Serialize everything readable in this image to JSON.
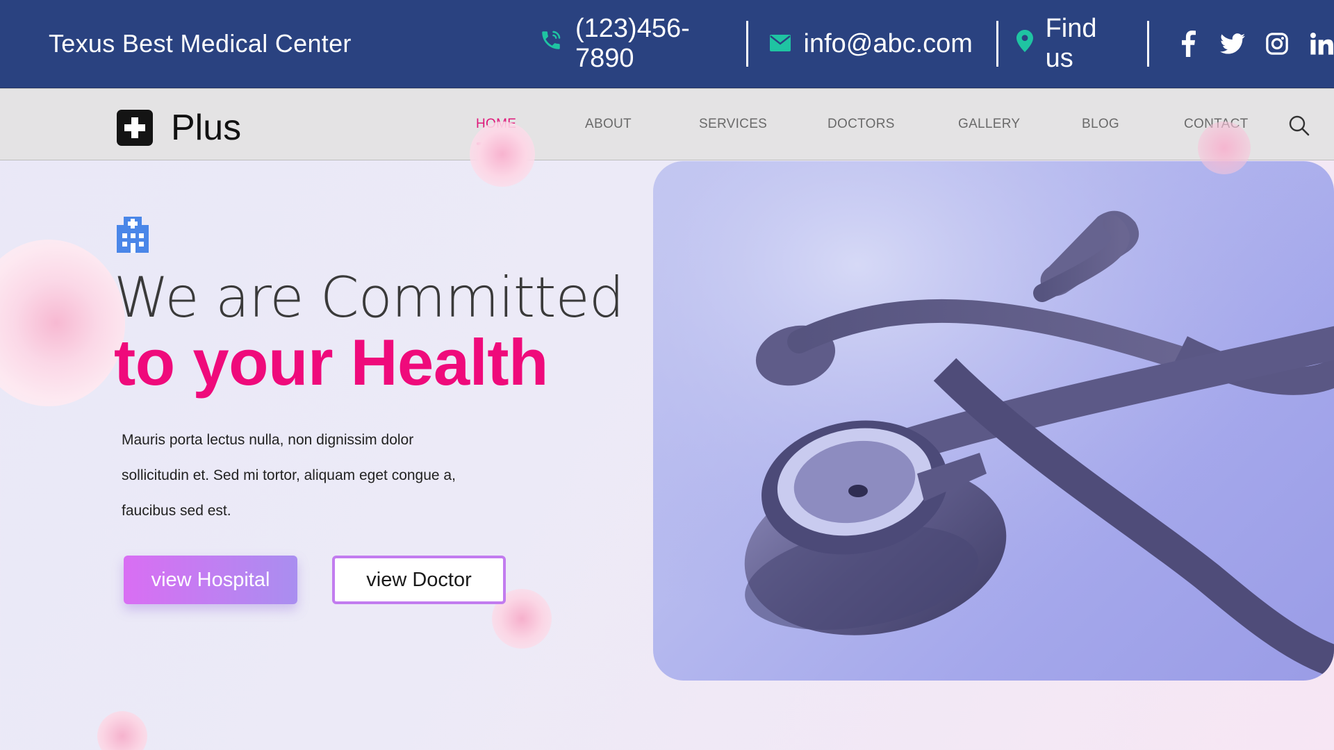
{
  "topbar": {
    "site_name": "Texus Best Medical Center",
    "phone": "(123)456-7890",
    "email": "info@abc.com",
    "location_label": "Find us",
    "phone_icon": "phone-icon",
    "email_icon": "mail-icon",
    "location_icon": "map-pin-icon",
    "social": [
      "facebook-icon",
      "twitter-icon",
      "instagram-icon",
      "linkedin-icon"
    ],
    "colors": {
      "background": "#2a4280",
      "icon_accent": "#1fc4a2"
    }
  },
  "navbar": {
    "logo_text": "Plus",
    "links": [
      "HOME",
      "ABOUT",
      "SERVICES",
      "DOCTORS",
      "GALLERY",
      "BLOG",
      "CONTACT"
    ],
    "active_link": "HOME",
    "colors": {
      "active": "#e0197a",
      "inactive": "#6a6a6a",
      "background": "#e4e3e4"
    }
  },
  "hero": {
    "line1": "We are Committed",
    "line2": "to your Health",
    "description_lines": [
      "Mauris porta lectus nulla, non dignissim dolor",
      "sollicitudin et. Sed mi tortor, aliquam eget congue a,",
      "faucibus sed est."
    ],
    "primary_button": "view Hospital",
    "secondary_button": "view Doctor",
    "icon": "hospital-building-icon",
    "image": "stethoscope-photo",
    "colors": {
      "highlight": "#ef0a7b",
      "button_gradient_start": "#d96ef3",
      "button_gradient_end": "#a98ef0"
    }
  }
}
